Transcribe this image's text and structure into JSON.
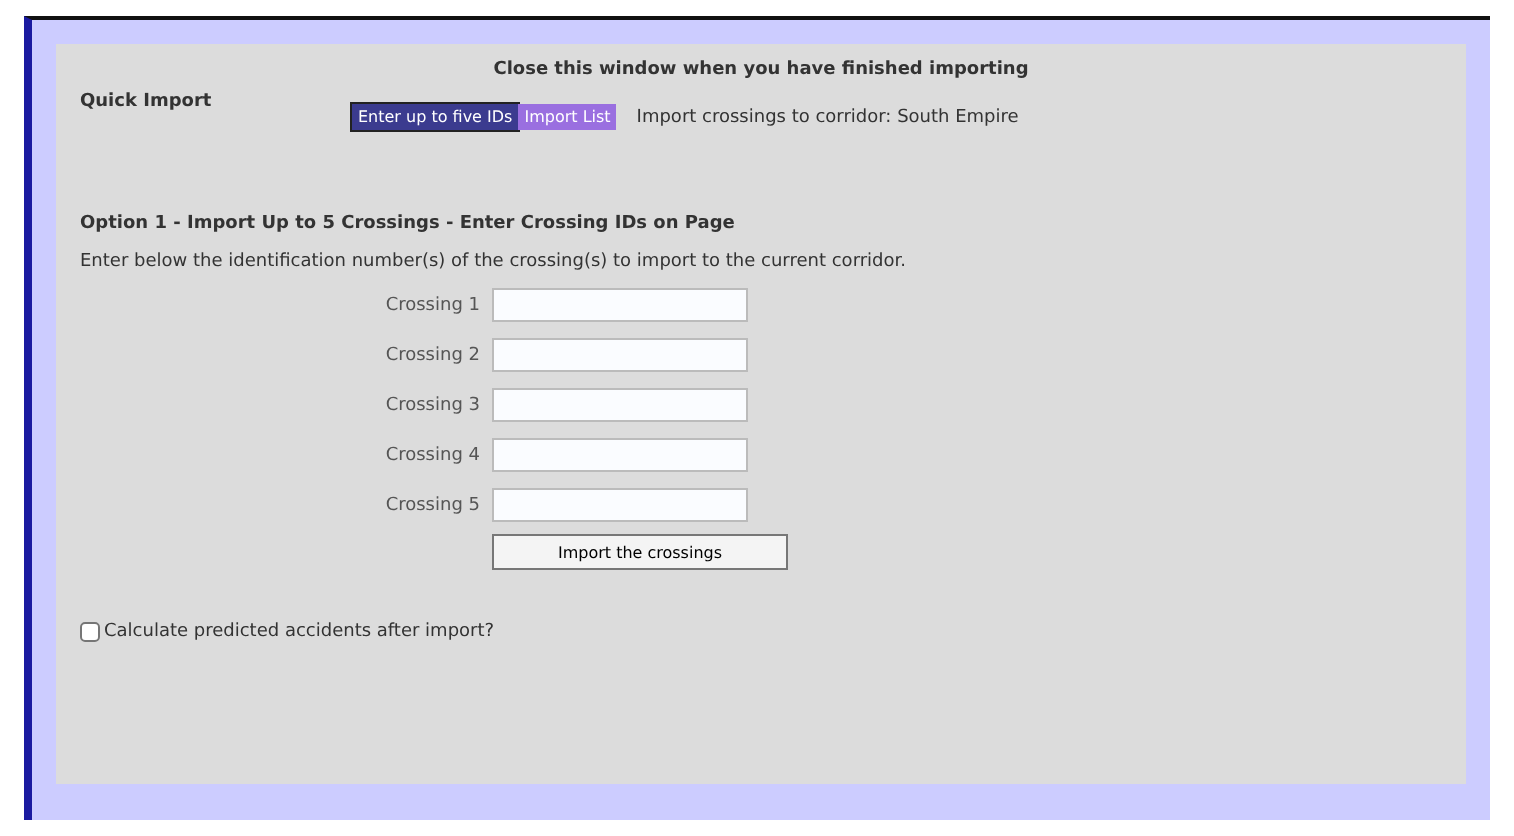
{
  "header": "Close this window when you have finished importing",
  "quick_import": {
    "label": "Quick Import",
    "tabs": [
      {
        "label": "Enter up to five IDs",
        "selected": true
      },
      {
        "label": "Import List",
        "selected": false
      }
    ],
    "note": "Import crossings to corridor: South Empire"
  },
  "option": {
    "title": "Option 1 - Import Up to 5 Crossings - Enter Crossing IDs on Page",
    "instructions": "Enter below the identification number(s) of the crossing(s) to import to the current corridor.",
    "fields": [
      {
        "label": "Crossing 1"
      },
      {
        "label": "Crossing 2"
      },
      {
        "label": "Crossing 3"
      },
      {
        "label": "Crossing 4"
      },
      {
        "label": "Crossing 5"
      }
    ],
    "button": "Import the crossings"
  },
  "calculate": {
    "label": "Calculate predicted accidents after import?",
    "checked": false
  }
}
